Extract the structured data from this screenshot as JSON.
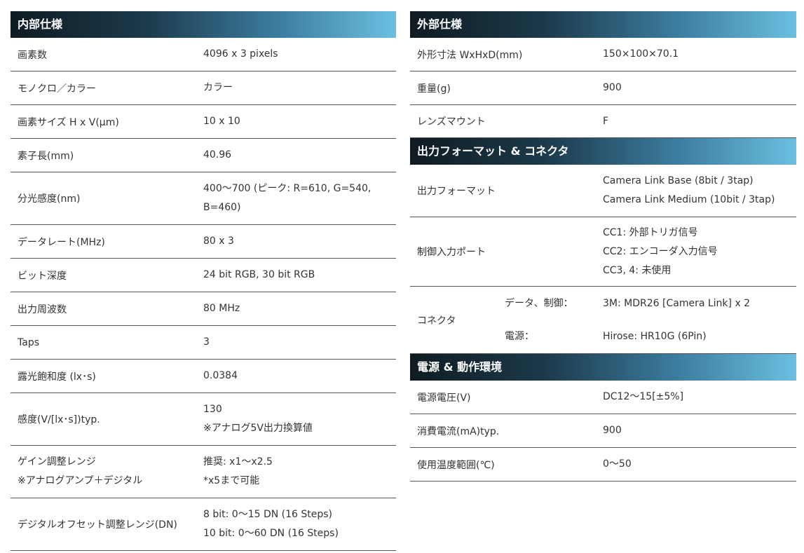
{
  "left": {
    "title": "内部仕様",
    "rows": [
      {
        "key": "画素数",
        "values": [
          "4096 x 3 pixels"
        ]
      },
      {
        "key": "モノクロ／カラー",
        "values": [
          "カラー"
        ]
      },
      {
        "key": "画素サイズ H x V(μm)",
        "values": [
          "10 x 10"
        ]
      },
      {
        "key": "素子長(mm)",
        "values": [
          "40.96"
        ]
      },
      {
        "key": "分光感度(nm)",
        "values": [
          "400～700 (ピーク: R=610, G=540,",
          "B=460)"
        ]
      },
      {
        "key": "データレート(MHz)",
        "values": [
          "80 x 3"
        ]
      },
      {
        "key": "ビット深度",
        "values": [
          "24 bit RGB, 30 bit RGB"
        ]
      },
      {
        "key": "出力周波数",
        "values": [
          "80 MHz"
        ]
      },
      {
        "key": "Taps",
        "values": [
          "3"
        ]
      },
      {
        "key": "露光飽和度 (lx･s)",
        "values": [
          "0.0384"
        ]
      },
      {
        "key": "感度(V/[lx･s])typ.",
        "values": [
          "130",
          "※アナログ5V出力換算値"
        ]
      },
      {
        "key": [
          "ゲイン調整レンジ",
          "※アナログアンプ＋デジタル"
        ],
        "values": [
          "推奨: x1～x2.5",
          "*x5まで可能"
        ]
      },
      {
        "key": "デジタルオフセット調整レンジ(DN)",
        "values": [
          "8 bit: 0～15 DN (16 Steps)",
          "10 bit: 0～60 DN (16 Steps)"
        ]
      }
    ]
  },
  "right": {
    "external": {
      "title": "外部仕様",
      "rows": [
        {
          "key": "外形寸法 WxHxD(mm)",
          "values": [
            "150×100×70.1"
          ]
        },
        {
          "key": "重量(g)",
          "values": [
            "900"
          ]
        },
        {
          "key": "レンズマウント",
          "values": [
            "F"
          ]
        }
      ]
    },
    "output": {
      "title": "出力フォーマット & コネクタ",
      "rows": [
        {
          "key": "出力フォーマット",
          "values": [
            "Camera Link Base (8bit / 3tap)",
            "Camera Link Medium (10bit / 3tap)"
          ]
        },
        {
          "key": "制御入力ポート",
          "values": [
            "CC1: 外部トリガ信号",
            "CC2: エンコーダ入力信号",
            "CC3, 4: 未使用"
          ]
        }
      ],
      "connector": {
        "key": "コネクタ",
        "lines": [
          {
            "label": "データ、制御：",
            "value": "3M: MDR26 [Camera Link] x 2"
          },
          {
            "label": "電源：",
            "value": "Hirose: HR10G (6Pin)"
          }
        ]
      }
    },
    "power": {
      "title": "電源 & 動作環境",
      "rows": [
        {
          "key": "電源電圧(V)",
          "values": [
            "DC12～15[±5%]"
          ]
        },
        {
          "key": "消費電流(mA)typ.",
          "values": [
            "900"
          ]
        },
        {
          "key": "使用温度範囲(℃)",
          "values": [
            "0～50"
          ]
        }
      ]
    }
  }
}
